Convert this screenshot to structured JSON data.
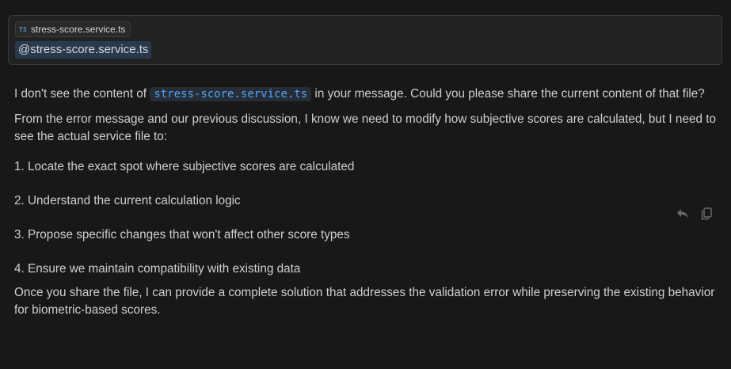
{
  "user_message": {
    "file_chip": {
      "icon": "TS",
      "label": "stress-score.service.ts"
    },
    "mention_text": "@stress-score.service.ts"
  },
  "assistant_message": {
    "p1_before": "I don't see the content of ",
    "p1_code": "stress-score.service.ts",
    "p1_after": " in your message. Could you please share the current content of that file?",
    "p2": "From the error message and our previous discussion, I know we need to modify how subjective scores are calculated, but I need to see the actual service file to:",
    "list": [
      "1. Locate the exact spot where subjective scores are calculated",
      "2. Understand the current calculation logic",
      "3. Propose specific changes that won't affect other score types",
      "4. Ensure we maintain compatibility with existing data"
    ],
    "p3": "Once you share the file, I can provide a complete solution that addresses the validation error while preserving the existing behavior for biometric-based scores."
  },
  "actions": {
    "icons": [
      "reply-icon",
      "copy-icon"
    ]
  },
  "colors": {
    "background": "#181818",
    "user_bubble": "#222222",
    "code_text": "#4fa3f7",
    "mention_bg": "#2a3a4e"
  }
}
